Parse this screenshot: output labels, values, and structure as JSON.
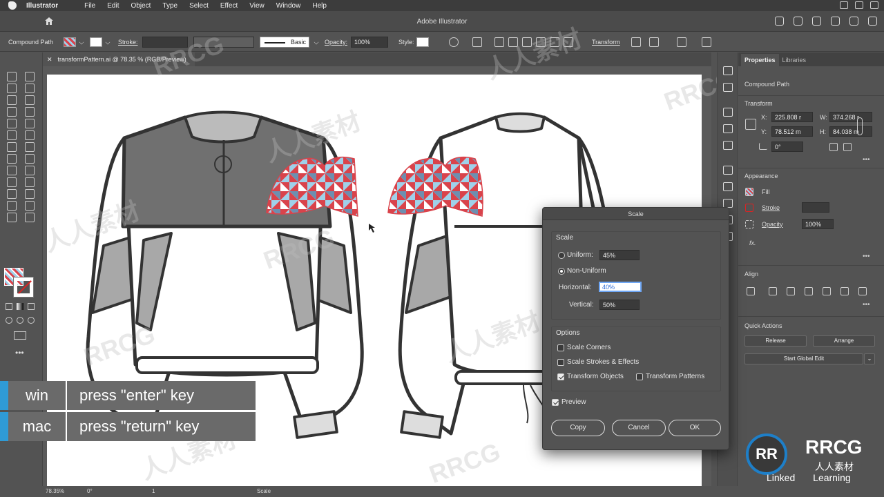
{
  "menubar": {
    "app": "Illustrator",
    "items": [
      "File",
      "Edit",
      "Object",
      "Type",
      "Select",
      "Effect",
      "View",
      "Window",
      "Help"
    ]
  },
  "titlebar": {
    "title": "Adobe Illustrator"
  },
  "control_bar": {
    "selection_type": "Compound Path",
    "stroke_label": "Stroke:",
    "brush_label": "Basic",
    "opacity_label": "Opacity:",
    "opacity_value": "100%",
    "style_label": "Style:",
    "transform_label": "Transform"
  },
  "document_tab": {
    "name": "transformPattern.ai @ 78.35 % (RGB/Preview)"
  },
  "properties_panel": {
    "tabs": [
      "Properties",
      "Libraries"
    ],
    "selection": "Compound Path",
    "transform": {
      "title": "Transform",
      "x_label": "X:",
      "x": "225.808 r",
      "y_label": "Y:",
      "y": "78.512 m",
      "w_label": "W:",
      "w": "374.268 r",
      "h_label": "H:",
      "h": "84.038 m",
      "angle": "0°"
    },
    "appearance": {
      "title": "Appearance",
      "fill_label": "Fill",
      "stroke_label": "Stroke",
      "opacity_label": "Opacity",
      "opacity_value": "100%",
      "fx_label": "fx."
    },
    "align": {
      "title": "Align"
    },
    "quick_actions": {
      "title": "Quick Actions",
      "release": "Release",
      "arrange": "Arrange",
      "start_global_edit": "Start Global Edit"
    }
  },
  "scale_dialog": {
    "title": "Scale",
    "scale_section": "Scale",
    "uniform_label": "Uniform:",
    "uniform_value": "45%",
    "non_uniform_label": "Non-Uniform",
    "mode": "non-uniform",
    "horizontal_label": "Horizontal:",
    "horizontal_value": "40%",
    "vertical_label": "Vertical:",
    "vertical_value": "50%",
    "options_section": "Options",
    "options": [
      {
        "label": "Scale Corners",
        "checked": false
      },
      {
        "label": "Scale Strokes & Effects",
        "checked": false
      },
      {
        "label": "Transform Objects",
        "checked": true
      },
      {
        "label": "Transform Patterns",
        "checked": false
      }
    ],
    "preview_label": "Preview",
    "preview_checked": true,
    "buttons": {
      "copy": "Copy",
      "cancel": "Cancel",
      "ok": "OK"
    }
  },
  "caption": {
    "rows": [
      {
        "os": "win",
        "action": "press \"enter\" key"
      },
      {
        "os": "mac",
        "action": "press \"return\" key"
      }
    ]
  },
  "status_bar": {
    "zoom": "78.35%",
    "rotation": "0°",
    "artboard": "1",
    "tool": "Scale"
  },
  "watermarks": {
    "brand": "RRCG",
    "cn": "人人素材"
  },
  "branding": {
    "logo_mark": "RR",
    "logo_text": "RRCG",
    "logo_sub": "人人素材",
    "linkedin": "Linked",
    "learning": "Learning"
  },
  "colors": {
    "accent_blue": "#2f9bd6",
    "pattern_red": "#d9434b",
    "pattern_light_blue": "#9fd1ea",
    "pattern_slate": "#6d8fb0",
    "garment_dark": "#707070",
    "garment_light": "#a8a8a8"
  },
  "icons": [
    "home-icon",
    "selection-tool-icon",
    "direct-selection-icon",
    "pen-icon",
    "type-icon",
    "brush-icon",
    "scale-tool-icon",
    "zoom-icon",
    "hand-icon",
    "search-icon",
    "share-icon"
  ]
}
